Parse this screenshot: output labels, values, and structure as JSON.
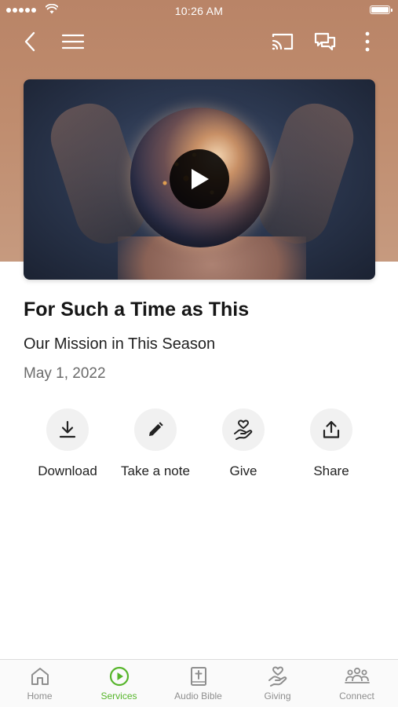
{
  "status_bar": {
    "time": "10:26 AM"
  },
  "colors": {
    "accent": "#56b52a",
    "header_bg": "#bf8c6e",
    "icon_gray": "#8e8e8e"
  },
  "top_nav": {
    "back_icon": "chevron-left-icon",
    "menu_icon": "hamburger-menu-icon",
    "cast_icon": "cast-icon",
    "chat_icon": "chat-bubbles-icon",
    "more_icon": "more-vertical-icon"
  },
  "video": {
    "play_icon": "play-icon"
  },
  "sermon": {
    "title": "For Such a Time as This",
    "subtitle": "Our Mission in This Season",
    "date": "May 1, 2022"
  },
  "actions": [
    {
      "label": "Download",
      "icon": "download-icon"
    },
    {
      "label": "Take a note",
      "icon": "pencil-icon"
    },
    {
      "label": "Give",
      "icon": "hand-heart-icon"
    },
    {
      "label": "Share",
      "icon": "share-icon"
    }
  ],
  "tabs": [
    {
      "label": "Home",
      "icon": "home-icon",
      "active": false
    },
    {
      "label": "Services",
      "icon": "play-circle-icon",
      "active": true
    },
    {
      "label": "Audio Bible",
      "icon": "bible-icon",
      "active": false
    },
    {
      "label": "Giving",
      "icon": "hand-heart-icon",
      "active": false
    },
    {
      "label": "Connect",
      "icon": "people-icon",
      "active": false
    }
  ]
}
